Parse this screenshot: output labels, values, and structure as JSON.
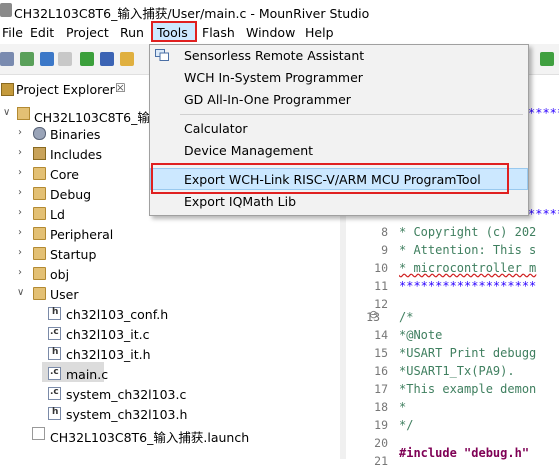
{
  "window": {
    "title": "CH32L103C8T6_输入捕获/User/main.c - MounRiver Studio"
  },
  "menubar": {
    "items": [
      "File",
      "Edit",
      "Project",
      "Run",
      "Tools",
      "Flash",
      "Window",
      "Help"
    ],
    "active": "Tools"
  },
  "tools_menu": {
    "items": [
      "Sensorless Remote Assistant",
      "WCH In-System Programmer",
      "GD All-In-One Programmer",
      "Calculator",
      "Device Management",
      "Export WCH-Link RISC-V/ARM MCU ProgramTool",
      "Export IQMath Lib"
    ],
    "highlighted": "Export WCH-Link RISC-V/ARM MCU ProgramTool"
  },
  "explorer": {
    "tab_title": "Project Explorer",
    "close_glyph": "☒",
    "project": "CH32L103C8T6_输入",
    "folders": [
      "Binaries",
      "Includes",
      "Core",
      "Debug",
      "Ld",
      "Peripheral",
      "Startup",
      "obj",
      "User"
    ],
    "user_files": [
      "ch32l103_conf.h",
      "ch32l103_it.c",
      "ch32l103_it.h",
      "main.c",
      "system_ch32l103.c",
      "system_ch32l103.h"
    ],
    "launch_file": "CH32L103C8T6_输入捕获.launch",
    "selected": "main.c"
  },
  "editor": {
    "lines": [
      {
        "no": "8",
        "text": " * Copyright (c) 202"
      },
      {
        "no": "9",
        "text": " * Attention: This s"
      },
      {
        "no": "10",
        "text": " * microcontroller m"
      },
      {
        "no": "11",
        "text": " *******************"
      },
      {
        "no": "12",
        "text": ""
      },
      {
        "no": "13",
        "text": "/*"
      },
      {
        "no": "14",
        "text": " *@Note"
      },
      {
        "no": "15",
        "text": " *USART Print debugg"
      },
      {
        "no": "16",
        "text": " *USART1_Tx(PA9)."
      },
      {
        "no": "17",
        "text": " *This example demon"
      },
      {
        "no": "18",
        "text": " *"
      },
      {
        "no": "19",
        "text": " */"
      },
      {
        "no": "20",
        "text": ""
      },
      {
        "no": "21",
        "text": "#include \"debug.h\""
      }
    ],
    "stars_top": "******",
    "stars_mid": "******",
    "fold_marker": "⊖"
  }
}
